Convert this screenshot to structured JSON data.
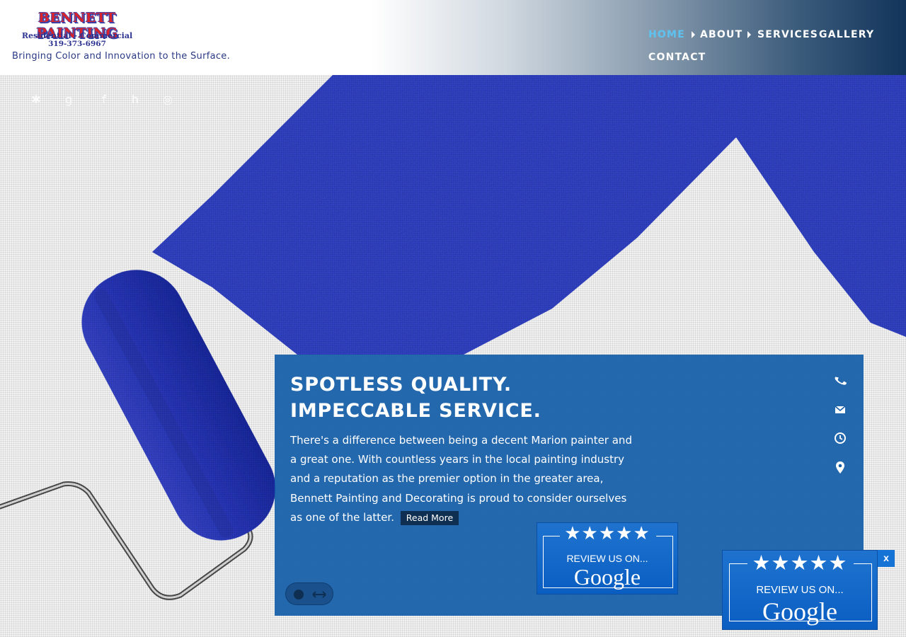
{
  "header": {
    "logo": {
      "title": "BENNETT PAINTING",
      "subtitle": "Residential - Commercial",
      "phone": "319-373-6967"
    },
    "tagline": "Bringing Color and Innovation to the Surface."
  },
  "nav": {
    "items": [
      {
        "label": "HOME",
        "active": true
      },
      {
        "label": "ABOUT"
      },
      {
        "label": "SERVICES"
      },
      {
        "label": "GALLERY"
      },
      {
        "label": "CONTACT"
      }
    ]
  },
  "social": {
    "icons": [
      "yelp-icon",
      "google-plus-icon",
      "facebook-icon",
      "houzz-icon",
      "angies-list-icon"
    ]
  },
  "hero": {
    "title": "SPOTLESS QUALITY. IMPECCABLE SERVICE.",
    "body": "There's a difference between being a decent Marion painter and a great one. With countless years in the local painting industry and a reputation as the premier option in the greater area, Bennett Painting and Decorating is proud to consider ourselves as one of the latter.",
    "read_more": "Read More",
    "contact_icons": [
      "phone-icon",
      "envelope-icon",
      "clock-icon",
      "map-pin-icon"
    ]
  },
  "review_badge": {
    "stars": "★★★★★",
    "text": "REVIEW US ON...",
    "brand": "Google",
    "close": "x"
  },
  "colors": {
    "panel": "#125ca8",
    "paint": "#3a4dd6",
    "nav_active": "#5ec2f0",
    "badge": "#1673d6"
  }
}
